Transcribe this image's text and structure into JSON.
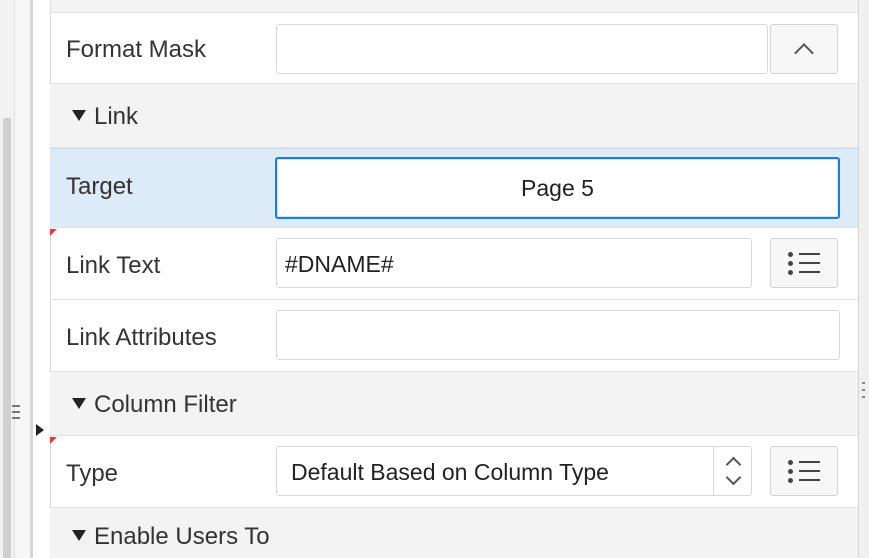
{
  "properties": {
    "format_mask": {
      "label": "Format Mask",
      "value": ""
    },
    "link_section": {
      "label": "Link"
    },
    "target": {
      "label": "Target",
      "value": "Page 5"
    },
    "link_text": {
      "label": "Link Text",
      "value": "#DNAME#"
    },
    "link_attributes": {
      "label": "Link Attributes",
      "value": ""
    },
    "column_filter_section": {
      "label": "Column Filter"
    },
    "type": {
      "label": "Type",
      "value": "Default Based on Column Type"
    },
    "enable_users_section": {
      "label": "Enable Users To"
    }
  },
  "icons": {
    "format_mask_button": "caret-up-icon",
    "link_text_button": "list-icon",
    "type_button": "list-icon",
    "select_arrows": "updown-chevron-icon"
  },
  "colors": {
    "selected_row": "#ddeaf7",
    "focus_border": "#1f7dd8",
    "required_marker": "#e53935",
    "section_bg": "#f3f3f3"
  }
}
